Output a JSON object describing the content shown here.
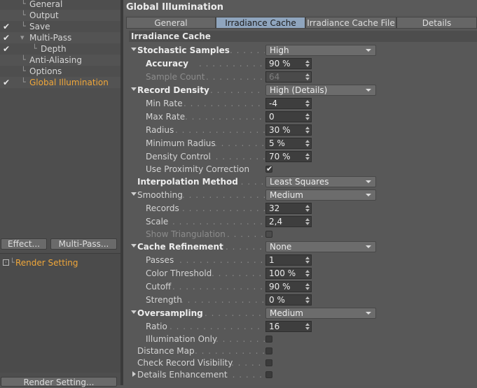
{
  "left_tree": {
    "items": [
      {
        "label": "General",
        "checked": false,
        "active": false,
        "indent": 1
      },
      {
        "label": "Output",
        "checked": false,
        "active": false,
        "indent": 1
      },
      {
        "label": "Save",
        "checked": true,
        "active": false,
        "indent": 1
      },
      {
        "label": "Multi-Pass",
        "checked": true,
        "active": false,
        "indent": 1
      },
      {
        "label": "Depth",
        "checked": true,
        "active": false,
        "indent": 2
      },
      {
        "label": "Anti-Aliasing",
        "checked": false,
        "active": false,
        "indent": 1
      },
      {
        "label": "Options",
        "checked": false,
        "active": false,
        "indent": 1
      },
      {
        "label": "Global Illumination",
        "checked": true,
        "active": true,
        "indent": 1
      }
    ],
    "effect_button": "Effect...",
    "multipass_button": "Multi-Pass...",
    "render_setting_item": "Render Setting",
    "render_setting_button": "Render Setting..."
  },
  "panel": {
    "title": "Global Illumination",
    "tabs": [
      "General",
      "Irradiance Cache",
      "Irradiance Cache File",
      "Details"
    ],
    "active_tab": 1,
    "section": "Irradiance Cache"
  },
  "params": {
    "stochastic_samples": {
      "label": "Stochastic Samples",
      "value": "High"
    },
    "accuracy": {
      "label": "Accuracy",
      "value": "90 %"
    },
    "sample_count": {
      "label": "Sample Count",
      "value": "64"
    },
    "record_density": {
      "label": "Record Density",
      "value": "High (Details)"
    },
    "min_rate": {
      "label": "Min Rate",
      "value": "-4"
    },
    "max_rate": {
      "label": "Max Rate",
      "value": "0"
    },
    "radius": {
      "label": "Radius",
      "value": "30 %"
    },
    "minimum_radius": {
      "label": "Minimum Radius",
      "value": "5 %"
    },
    "density_control": {
      "label": "Density Control",
      "value": "70 %"
    },
    "use_proximity": {
      "label": "Use Proximity Correction",
      "checked": true
    },
    "interpolation": {
      "label": "Interpolation Method",
      "value": "Least Squares"
    },
    "smoothing": {
      "label": "Smoothing",
      "value": "Medium"
    },
    "records": {
      "label": "Records",
      "value": "32"
    },
    "scale": {
      "label": "Scale",
      "value": "2,4"
    },
    "show_triangulation": {
      "label": "Show Triangulation",
      "checked": false
    },
    "cache_refinement": {
      "label": "Cache Refinement",
      "value": "None"
    },
    "passes": {
      "label": "Passes",
      "value": "1"
    },
    "color_threshold": {
      "label": "Color Threshold",
      "value": "100 %"
    },
    "cutoff": {
      "label": "Cutoff",
      "value": "90 %"
    },
    "strength": {
      "label": "Strength",
      "value": "0 %"
    },
    "oversampling": {
      "label": "Oversampling",
      "value": "Medium"
    },
    "ratio": {
      "label": "Ratio",
      "value": "16"
    },
    "illumination_only": {
      "label": "Illumination Only",
      "checked": false
    },
    "distance_map": {
      "label": "Distance Map",
      "checked": false
    },
    "check_record_visibility": {
      "label": "Check Record Visibility",
      "checked": false
    },
    "details_enhancement": {
      "label": "Details Enhancement",
      "checked": false
    }
  },
  "colors": {
    "accent": "#f0a73a",
    "active_tab": "#8fa5be"
  }
}
